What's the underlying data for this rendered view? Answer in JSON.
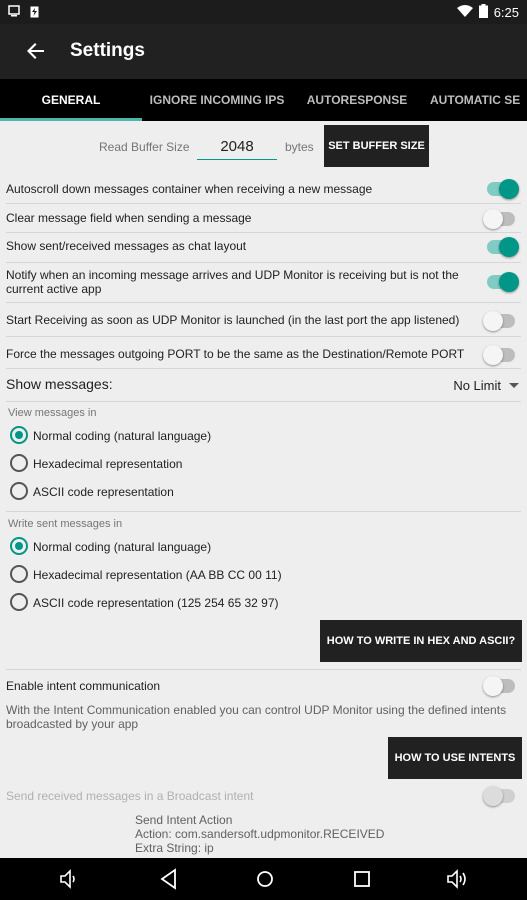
{
  "status_bar": {
    "time": "6:25"
  },
  "appbar": {
    "title": "Settings"
  },
  "tabs": [
    {
      "label": "GENERAL"
    },
    {
      "label": "IGNORE INCOMING IPS"
    },
    {
      "label": "AUTORESPONSE"
    },
    {
      "label": "AUTOMATIC SE"
    }
  ],
  "buffer": {
    "label": "Read Buffer Size",
    "value": "2048",
    "unit": "bytes",
    "button": "SET BUFFER SIZE"
  },
  "toggles": [
    {
      "label": "Autoscroll down messages container when receiving a new message",
      "on": true
    },
    {
      "label": "Clear message field when sending a message",
      "on": false
    },
    {
      "label": "Show sent/received messages as chat layout",
      "on": true
    },
    {
      "label": "Notify when an incoming message arrives and UDP Monitor is receiving but is not the current active app",
      "on": true
    },
    {
      "label": "Start Receiving as soon as UDP Monitor is launched (in the last port the app listened)",
      "on": false
    },
    {
      "label": "Force the messages outgoing PORT to be the same as the Destination/Remote PORT",
      "on": false
    }
  ],
  "show_messages": {
    "label": "Show messages:",
    "value": "No Limit"
  },
  "view_in": {
    "title": "View messages in",
    "options": [
      "Normal coding (natural language)",
      "Hexadecimal representation",
      "ASCII code representation"
    ],
    "selected": 0
  },
  "write_in": {
    "title": "Write sent messages in",
    "options": [
      "Normal coding (natural language)",
      "Hexadecimal representation (AA BB CC 00 11)",
      "ASCII code representation (125 254 65 32 97)"
    ],
    "selected": 0
  },
  "hex_button": "HOW TO WRITE IN HEX AND ASCII?",
  "intent": {
    "label": "Enable intent communication",
    "description": "With the Intent Communication enabled you can control UDP Monitor using the defined intents broadcasted by your app",
    "button": "HOW TO USE INTENTS",
    "broadcast_label": "Send received messages in a Broadcast intent",
    "info_lines": [
      "Send Intent Action",
      "Action: com.sandersoft.udpmonitor.RECEIVED",
      "Extra String: ip"
    ]
  },
  "colors": {
    "accent": "#009688",
    "appbar": "#212121",
    "tabbar": "#000000"
  }
}
